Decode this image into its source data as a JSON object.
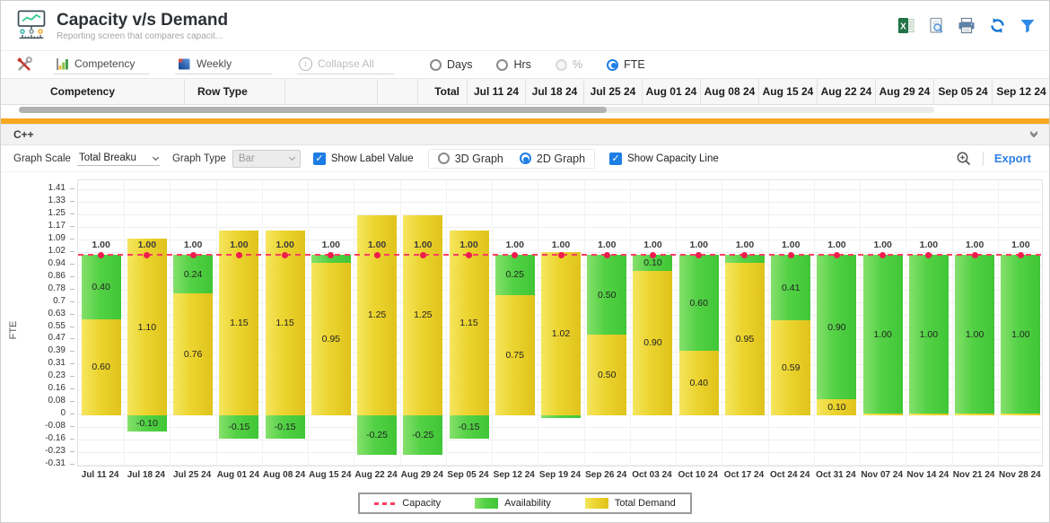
{
  "header": {
    "title": "Capacity v/s Demand",
    "subtitle": "Reporting screen that compares capacit...",
    "action_icons": [
      "excel-export-icon",
      "print-preview-icon",
      "print-icon",
      "refresh-icon",
      "filter-icon"
    ]
  },
  "toolbar": {
    "tools_icon": "tools-icon",
    "competency": "Competency",
    "weekly": "Weekly",
    "collapse_all": "Collapse All",
    "unit_options": [
      {
        "label": "Days",
        "selected": false,
        "disabled": false
      },
      {
        "label": "Hrs",
        "selected": false,
        "disabled": false
      },
      {
        "label": "%",
        "selected": false,
        "disabled": true
      },
      {
        "label": "FTE",
        "selected": true,
        "disabled": false
      }
    ]
  },
  "table": {
    "columns": [
      "Competency",
      "Row Type",
      "",
      "",
      "Total"
    ],
    "date_columns": [
      "Jul 11 24",
      "Jul 18 24",
      "Jul 25 24",
      "Aug 01 24",
      "Aug 08 24",
      "Aug 15 24",
      "Aug 22 24",
      "Aug 29 24",
      "Sep 05 24",
      "Sep 12 24"
    ]
  },
  "section": {
    "title": "C++"
  },
  "graph_controls": {
    "graph_scale_label": "Graph Scale",
    "graph_scale_value": "Total Breaku",
    "graph_type_label": "Graph Type",
    "graph_type_value": "Bar",
    "show_label_value_label": "Show Label Value",
    "show_label_value_checked": true,
    "graph_3d_label": "3D Graph",
    "graph_3d_selected": false,
    "graph_2d_label": "2D Graph",
    "graph_2d_selected": true,
    "show_capacity_line_label": "Show Capacity Line",
    "show_capacity_line_checked": true,
    "zoom_icon": "zoom-in-icon",
    "export_label": "Export"
  },
  "chart_data": {
    "type": "bar",
    "stacked": true,
    "ylabel": "FTE",
    "ylim": [
      -0.31,
      1.41
    ],
    "grid": true,
    "legend_position": "bottom",
    "yticks": [
      "1.41",
      "1.33",
      "1.25",
      "1.17",
      "1.09",
      "1.02",
      "0.94",
      "0.86",
      "0.78",
      "0.7",
      "0.63",
      "0.55",
      "0.47",
      "0.39",
      "0.31",
      "0.23",
      "0.16",
      "0.08",
      "0",
      "-0.08",
      "-0.16",
      "-0.23",
      "-0.31"
    ],
    "capacity_line": {
      "value": 1.0,
      "label": "1.00",
      "color": "#fb3d62",
      "style": "dashed"
    },
    "categories": [
      "Jul 11 24",
      "Jul 18 24",
      "Jul 25 24",
      "Aug 01 24",
      "Aug 08 24",
      "Aug 15 24",
      "Aug 22 24",
      "Aug 29 24",
      "Sep 05 24",
      "Sep 12 24",
      "Sep 19 24",
      "Sep 26 24",
      "Oct 03 24",
      "Oct 10 24",
      "Oct 17 24",
      "Oct 24 24",
      "Oct 31 24",
      "Nov 07 24",
      "Nov 14 24",
      "Nov 21 24",
      "Nov 28 24"
    ],
    "series": [
      {
        "name": "Total Demand",
        "color": "#e6ca25",
        "values": [
          0.6,
          1.1,
          0.76,
          1.15,
          1.15,
          0.95,
          1.25,
          1.25,
          1.15,
          0.75,
          1.02,
          0.5,
          0.9,
          0.4,
          0.95,
          0.59,
          0.1,
          0,
          0,
          0,
          0
        ],
        "labels": [
          "0.60",
          "1.10",
          "0.76",
          "1.15",
          "1.15",
          "0.95",
          "1.25",
          "1.25",
          "1.15",
          "0.75",
          "1.02",
          "0.50",
          "0.90",
          "0.40",
          "0.95",
          "0.59",
          "0.10",
          "",
          "",
          "",
          ""
        ]
      },
      {
        "name": "Availability",
        "color": "#4ecb41",
        "values": [
          0.4,
          -0.1,
          0.24,
          -0.15,
          -0.15,
          0.05,
          -0.25,
          -0.25,
          -0.15,
          0.25,
          -0.02,
          0.5,
          0.1,
          0.6,
          0.05,
          0.41,
          0.9,
          1.0,
          1.0,
          1.0,
          1.0
        ],
        "labels": [
          "0.40",
          "-0.10",
          "0.24",
          "-0.15",
          "-0.15",
          "",
          "-0.25",
          "-0.25",
          "-0.15",
          "0.25",
          "",
          "0.50",
          "0.10",
          "0.60",
          "",
          "0.41",
          "0.90",
          "1.00",
          "1.00",
          "1.00",
          "1.00"
        ]
      }
    ],
    "legend": [
      {
        "label": "Capacity",
        "swatch": "dashed-line",
        "color": "#fb3d62"
      },
      {
        "label": "Availability",
        "swatch": "box",
        "color": "#4ecb41"
      },
      {
        "label": "Total Demand",
        "swatch": "box",
        "color": "#e6ca25"
      }
    ]
  }
}
